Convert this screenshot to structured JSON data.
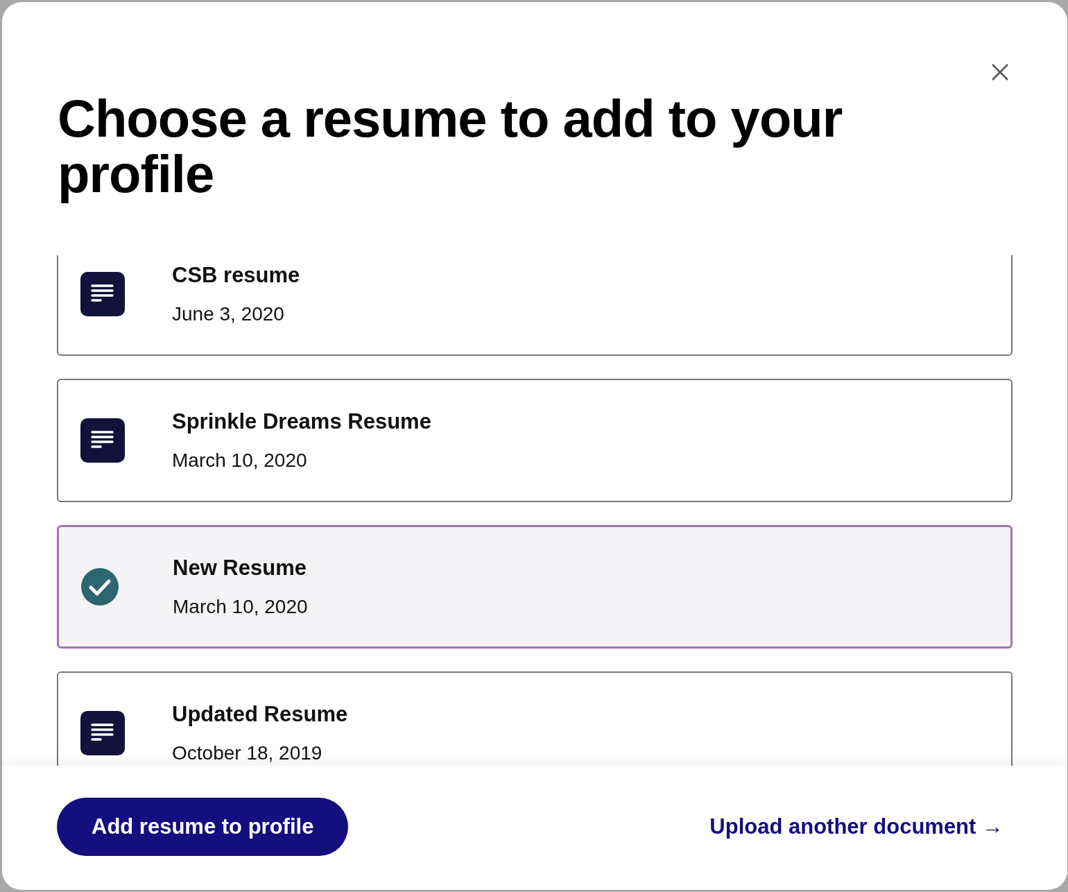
{
  "dialog": {
    "title": "Choose a resume to add to your profile"
  },
  "resumes": [
    {
      "name": "CSB resume",
      "date": "June 3, 2020",
      "selected": false
    },
    {
      "name": "Sprinkle Dreams Resume",
      "date": "March 10, 2020",
      "selected": false
    },
    {
      "name": "New Resume",
      "date": "March 10, 2020",
      "selected": true
    },
    {
      "name": "Updated Resume",
      "date": "October 18, 2019",
      "selected": false
    }
  ],
  "footer": {
    "primary_button": "Add resume to profile",
    "link": "Upload another document →"
  }
}
